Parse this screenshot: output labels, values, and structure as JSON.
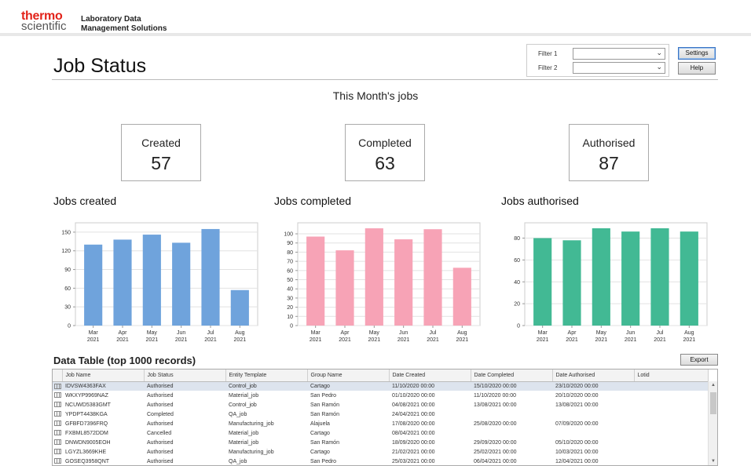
{
  "header": {
    "logo_line1": "thermo",
    "logo_line2": "scientific",
    "app_title_line1": "Laboratory Data",
    "app_title_line2": "Management Solutions"
  },
  "page": {
    "title": "Job Status"
  },
  "filters": {
    "filter1_label": "Filter 1",
    "filter2_label": "Filter 2",
    "filter1_value": "",
    "filter2_value": "",
    "chevron_icon": "chevron-down-icon"
  },
  "buttons": {
    "settings": "Settings",
    "help": "Help",
    "export": "Export"
  },
  "month": {
    "heading": "This Month's jobs",
    "cards": [
      {
        "label": "Created",
        "value": "57"
      },
      {
        "label": "Completed",
        "value": "63"
      },
      {
        "label": "Authorised",
        "value": "87"
      }
    ]
  },
  "colors": {
    "created": "#6fa3dc",
    "completed": "#f7a3b6",
    "authorised": "#42b994",
    "logo_red": "#e2231a"
  },
  "charts": {
    "titles": [
      "Jobs created",
      "Jobs completed",
      "Jobs authorised"
    ]
  },
  "chart_data": [
    {
      "type": "bar",
      "title": "Jobs created",
      "categories": [
        [
          "Mar",
          "2021"
        ],
        [
          "Apr",
          "2021"
        ],
        [
          "May",
          "2021"
        ],
        [
          "Jun",
          "2021"
        ],
        [
          "Jul",
          "2021"
        ],
        [
          "Aug",
          "2021"
        ]
      ],
      "values": [
        130,
        138,
        146,
        133,
        155,
        57
      ],
      "ylim": [
        0,
        165
      ],
      "yticks": [
        0,
        30,
        60,
        90,
        120,
        150
      ],
      "grid": true,
      "color": "#6fa3dc"
    },
    {
      "type": "bar",
      "title": "Jobs completed",
      "categories": [
        [
          "Mar",
          "2021"
        ],
        [
          "Apr",
          "2021"
        ],
        [
          "May",
          "2021"
        ],
        [
          "Jun",
          "2021"
        ],
        [
          "Jul",
          "2021"
        ],
        [
          "Aug",
          "2021"
        ]
      ],
      "values": [
        97,
        82,
        106,
        94,
        105,
        63
      ],
      "ylim": [
        0,
        112
      ],
      "yticks": [
        0,
        10,
        20,
        30,
        40,
        50,
        60,
        70,
        80,
        90,
        100
      ],
      "grid": true,
      "color": "#f7a3b6"
    },
    {
      "type": "bar",
      "title": "Jobs authorised",
      "categories": [
        [
          "Mar",
          "2021"
        ],
        [
          "Apr",
          "2021"
        ],
        [
          "May",
          "2021"
        ],
        [
          "Jun",
          "2021"
        ],
        [
          "Jul",
          "2021"
        ],
        [
          "Aug",
          "2021"
        ]
      ],
      "values": [
        80,
        78,
        89,
        86,
        89,
        86
      ],
      "ylim": [
        0,
        94
      ],
      "yticks": [
        0,
        20,
        40,
        60,
        80
      ],
      "grid": true,
      "color": "#42b994"
    }
  ],
  "table": {
    "title": "Data Table (top 1000 records)",
    "columns": [
      "Job Name",
      "Job Status",
      "Entity Template",
      "Group Name",
      "Date Created",
      "Date Completed",
      "Date Authorised",
      "Lotid"
    ],
    "rows": [
      [
        "IDVSW4363FAX",
        "Authorised",
        "Control_job",
        "Cartago",
        "11/10/2020 00:00",
        "15/10/2020 00:00",
        "23/10/2020 00:00",
        ""
      ],
      [
        "WKXYP9969NAZ",
        "Authorised",
        "Material_job",
        "San Pedro",
        "01/10/2020 00:00",
        "11/10/2020 00:00",
        "20/10/2020 00:00",
        ""
      ],
      [
        "NCUWD5383GMT",
        "Authorised",
        "Control_job",
        "San Ramón",
        "04/08/2021 00:00",
        "13/08/2021 00:00",
        "13/08/2021 00:00",
        ""
      ],
      [
        "YPDPT4438KGA",
        "Completed",
        "QA_job",
        "San Ramón",
        "24/04/2021 00:00",
        "",
        "",
        ""
      ],
      [
        "GFBFD7396FRQ",
        "Authorised",
        "Manufacturing_job",
        "Alajuela",
        "17/08/2020 00:00",
        "25/08/2020 00:00",
        "07/09/2020 00:00",
        ""
      ],
      [
        "FXBML8572DDM",
        "Cancelled",
        "Material_job",
        "Cartago",
        "08/04/2021 00:00",
        "",
        "",
        ""
      ],
      [
        "DNWDN9005EOH",
        "Authorised",
        "Material_job",
        "San Ramón",
        "18/09/2020 00:00",
        "29/09/2020 00:00",
        "05/10/2020 00:00",
        ""
      ],
      [
        "LGYZL3669KHE",
        "Authorised",
        "Manufacturing_job",
        "Cartago",
        "21/02/2021 00:00",
        "25/02/2021 00:00",
        "10/03/2021 00:00",
        ""
      ],
      [
        "GOSEQ3958QNT",
        "Authorised",
        "QA_job",
        "San Pedro",
        "25/03/2021 00:00",
        "06/04/2021 00:00",
        "12/04/2021 00:00",
        ""
      ]
    ]
  }
}
